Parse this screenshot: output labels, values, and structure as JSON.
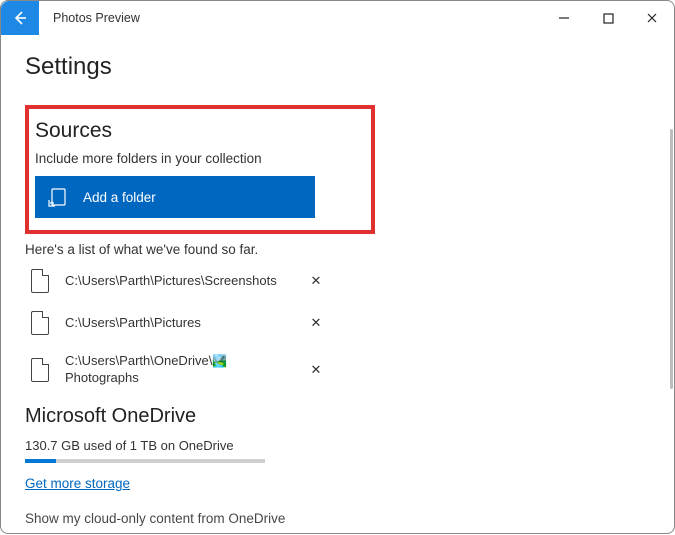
{
  "titlebar": {
    "app_title": "Photos Preview"
  },
  "page": {
    "title": "Settings"
  },
  "sources": {
    "heading": "Sources",
    "subtitle": "Include more folders in your collection",
    "add_button": "Add a folder",
    "list_intro": "Here's a list of what we've found so far.",
    "folders": [
      {
        "path": "C:\\Users\\Parth\\Pictures\\Screenshots",
        "has_pic_emoji": false
      },
      {
        "path": "C:\\Users\\Parth\\Pictures",
        "has_pic_emoji": false
      },
      {
        "path": "C:\\Users\\Parth\\OneDrive\\",
        "path_line2": "Photographs",
        "has_pic_emoji": true
      }
    ]
  },
  "onedrive": {
    "heading": "Microsoft OneDrive",
    "usage": "130.7 GB used of 1 TB on OneDrive",
    "storage_link": "Get more storage",
    "cutoff": "Show my cloud-only content from OneDrive"
  }
}
